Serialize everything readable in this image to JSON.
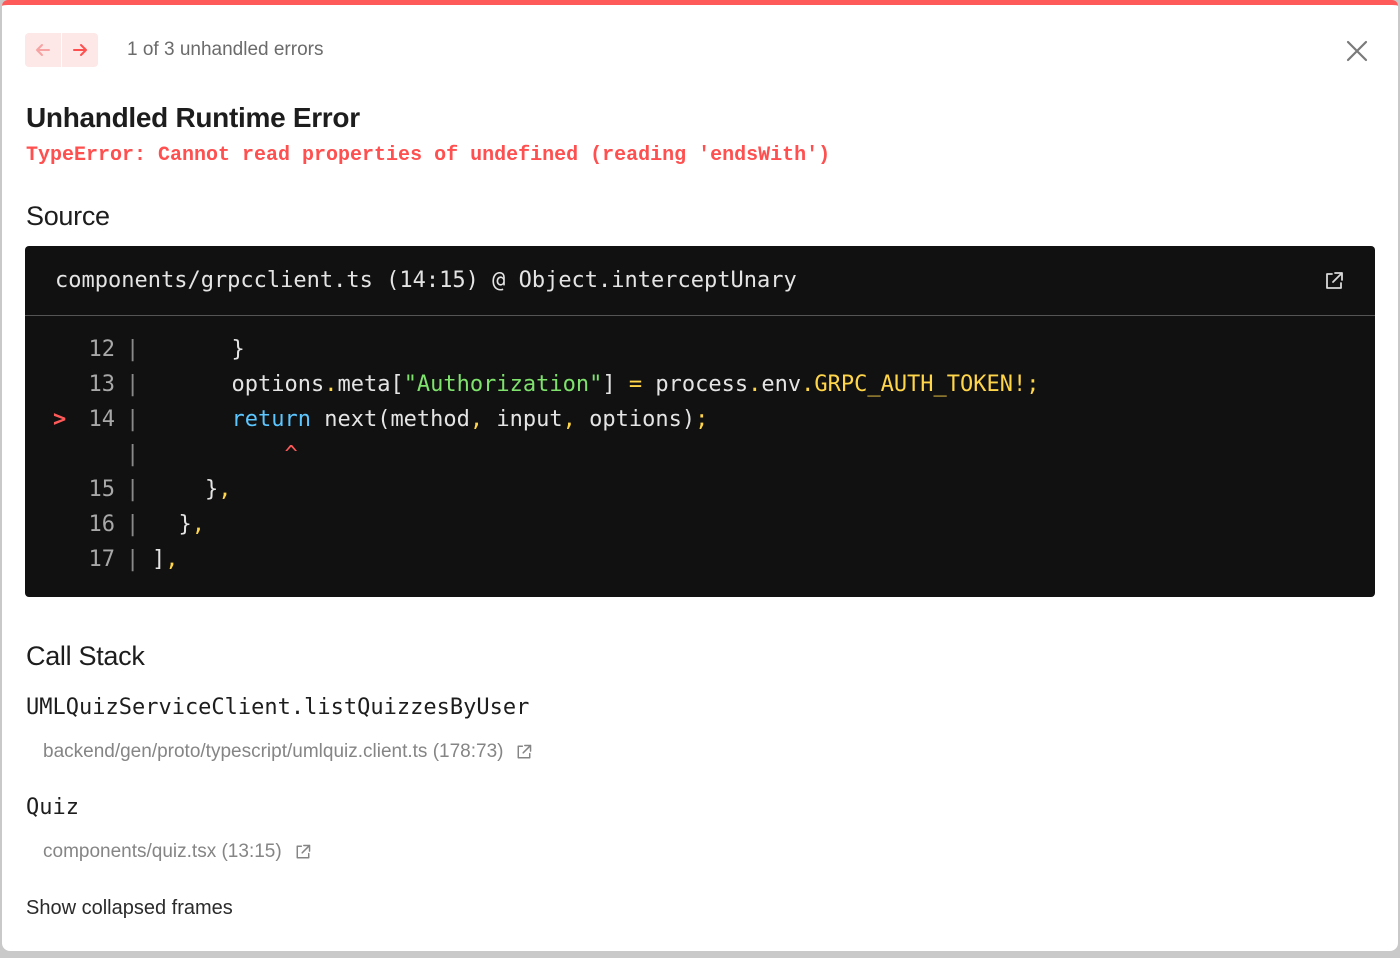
{
  "header": {
    "prev_icon": "arrow-left-icon",
    "next_icon": "arrow-right-icon",
    "error_count_text": "1 of 3 unhandled errors",
    "close_icon": "close-icon"
  },
  "error": {
    "title": "Unhandled Runtime Error",
    "message": "TypeError: Cannot read properties of undefined (reading 'endsWith')"
  },
  "source": {
    "section_title": "Source",
    "file_label": "components/grpcclient.ts (14:15) @ Object.interceptUnary",
    "open_icon": "external-link-icon",
    "lines": [
      {
        "marker": "",
        "number": "12",
        "pipe": "|",
        "indent": "      ",
        "tokens": [
          {
            "text": "}",
            "color": "default"
          }
        ]
      },
      {
        "marker": "",
        "number": "13",
        "pipe": "|",
        "indent": "      ",
        "tokens": [
          {
            "text": "options",
            "color": "default"
          },
          {
            "text": ".",
            "color": "yellow"
          },
          {
            "text": "meta[",
            "color": "default"
          },
          {
            "text": "\"Authorization\"",
            "color": "green"
          },
          {
            "text": "] ",
            "color": "default"
          },
          {
            "text": "=",
            "color": "yellow"
          },
          {
            "text": " process",
            "color": "default"
          },
          {
            "text": ".",
            "color": "yellow"
          },
          {
            "text": "env",
            "color": "default"
          },
          {
            "text": ".",
            "color": "yellow"
          },
          {
            "text": "GRPC_AUTH_TOKEN",
            "color": "yellow"
          },
          {
            "text": "!;",
            "color": "yellow"
          }
        ]
      },
      {
        "marker": ">",
        "number": "14",
        "pipe": "|",
        "indent": "      ",
        "tokens": [
          {
            "text": "return",
            "color": "blue"
          },
          {
            "text": " next(method",
            "color": "default"
          },
          {
            "text": ",",
            "color": "yellow"
          },
          {
            "text": " input",
            "color": "default"
          },
          {
            "text": ",",
            "color": "yellow"
          },
          {
            "text": " options)",
            "color": "default"
          },
          {
            "text": ";",
            "color": "yellow"
          }
        ]
      },
      {
        "marker": "",
        "number": "",
        "pipe": "|",
        "indent": "          ",
        "tokens": [
          {
            "text": "^",
            "color": "red"
          }
        ]
      },
      {
        "marker": "",
        "number": "15",
        "pipe": "|",
        "indent": "    ",
        "tokens": [
          {
            "text": "}",
            "color": "default"
          },
          {
            "text": ",",
            "color": "yellow"
          }
        ]
      },
      {
        "marker": "",
        "number": "16",
        "pipe": "|",
        "indent": "  ",
        "tokens": [
          {
            "text": "}",
            "color": "default"
          },
          {
            "text": ",",
            "color": "yellow"
          }
        ]
      },
      {
        "marker": "",
        "number": "17",
        "pipe": "|",
        "indent": "",
        "tokens": [
          {
            "text": "]",
            "color": "default"
          },
          {
            "text": ",",
            "color": "yellow"
          }
        ]
      }
    ]
  },
  "call_stack": {
    "section_title": "Call Stack",
    "frames": [
      {
        "function": "UMLQuizServiceClient.listQuizzesByUser",
        "location": "backend/gen/proto/typescript/umlquiz.client.ts (178:73)",
        "icon": "external-link-icon"
      },
      {
        "function": "Quiz",
        "location": "components/quiz.tsx (13:15)",
        "icon": "external-link-icon"
      }
    ],
    "show_collapsed_label": "Show collapsed frames"
  },
  "colors": {
    "accent": "#ff5a5a",
    "error_text": "#ff4f4f",
    "code_bg": "#111111",
    "token_yellow": "#ffd54a",
    "token_green": "#7ee26c",
    "token_blue": "#5bc6ff"
  }
}
